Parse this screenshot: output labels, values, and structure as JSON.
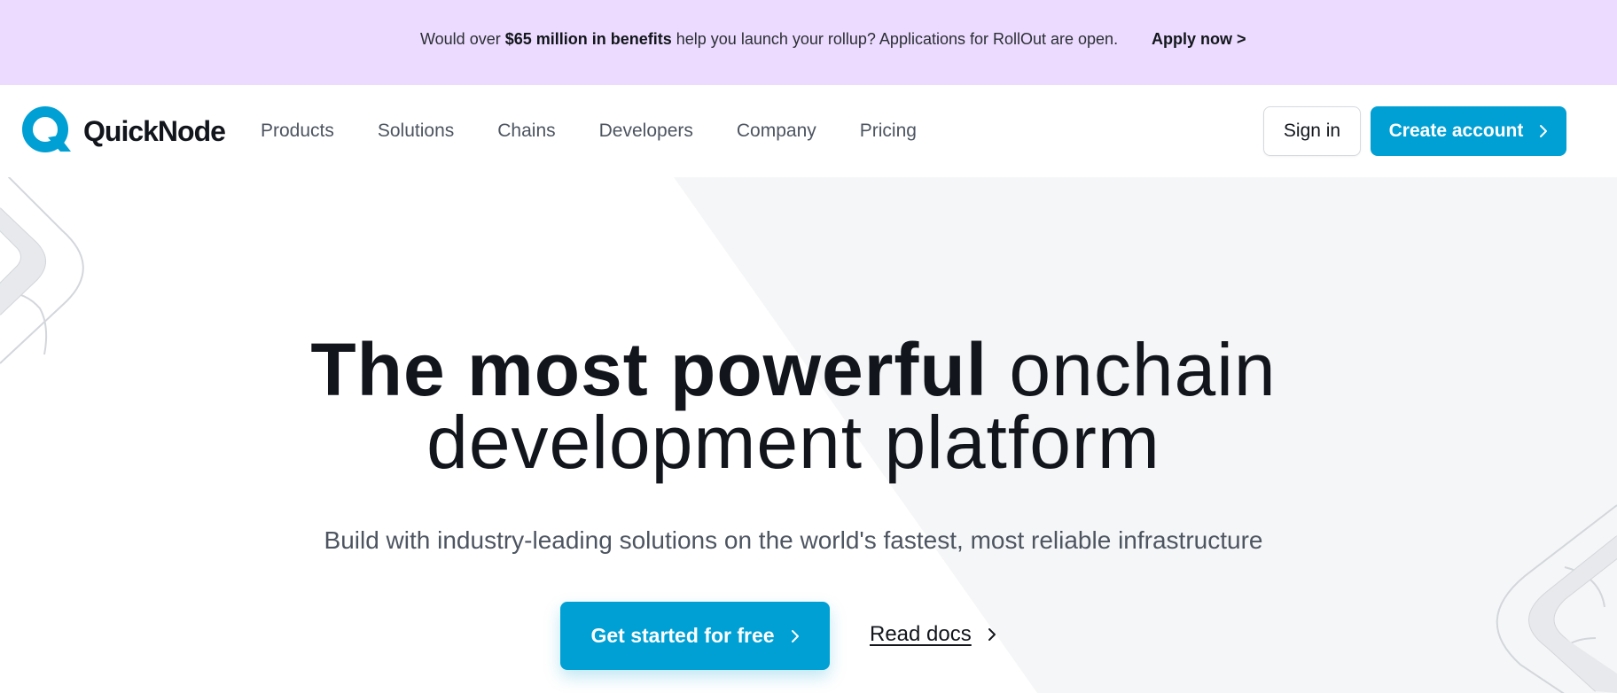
{
  "banner": {
    "text_before": "Would over ",
    "text_bold": "$65 million in benefits",
    "text_after": " help you launch your rollup? Applications for RollOut are open.",
    "cta_label": "Apply now >"
  },
  "nav": {
    "logo_text": "QuickNode",
    "links": [
      "Products",
      "Solutions",
      "Chains",
      "Developers",
      "Company",
      "Pricing"
    ],
    "signin_label": "Sign in",
    "create_label": "Create account"
  },
  "hero": {
    "title_strong": "The most powerful",
    "title_light_1": " onchain",
    "title_light_2": "development platform",
    "subtitle": "Build with industry-leading solutions on the world's fastest, most reliable infrastructure",
    "primary_cta": "Get started for free",
    "secondary_cta": "Read docs"
  },
  "colors": {
    "banner_bg": "#ecdbfe",
    "brand_accent": "#00a0d4",
    "heading": "#12161c",
    "body_text": "#4d5561"
  },
  "icons": {
    "logo": "quicknode-q-logo-icon",
    "chevron": "chevron-right-icon"
  }
}
